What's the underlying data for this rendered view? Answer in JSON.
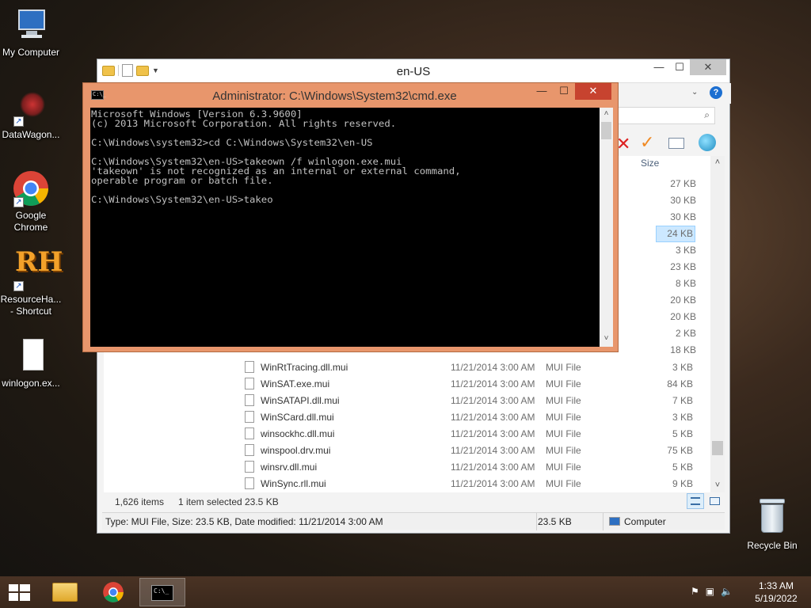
{
  "desktop": {
    "icons": [
      {
        "label": "My Computer"
      },
      {
        "label": "DataWagon..."
      },
      {
        "label": "Google Chrome"
      },
      {
        "label": "ResourceHa... - Shortcut"
      },
      {
        "label": "winlogon.ex..."
      },
      {
        "label": "Recycle Bin"
      }
    ]
  },
  "explorer": {
    "title": "en-US",
    "column_size": "Size",
    "upper_sizes": [
      "27 KB",
      "30 KB",
      "30 KB",
      "24 KB",
      "3 KB",
      "23 KB",
      "8 KB",
      "20 KB",
      "20 KB",
      "2 KB",
      "18 KB"
    ],
    "selected_index": 3,
    "rows": [
      {
        "name": "WinRtTracing.dll.mui",
        "date": "11/21/2014 3:00 AM",
        "type": "MUI File",
        "size": "3 KB"
      },
      {
        "name": "WinSAT.exe.mui",
        "date": "11/21/2014 3:00 AM",
        "type": "MUI File",
        "size": "84 KB"
      },
      {
        "name": "WinSATAPI.dll.mui",
        "date": "11/21/2014 3:00 AM",
        "type": "MUI File",
        "size": "7 KB"
      },
      {
        "name": "WinSCard.dll.mui",
        "date": "11/21/2014 3:00 AM",
        "type": "MUI File",
        "size": "3 KB"
      },
      {
        "name": "winsockhc.dll.mui",
        "date": "11/21/2014 3:00 AM",
        "type": "MUI File",
        "size": "5 KB"
      },
      {
        "name": "winspool.drv.mui",
        "date": "11/21/2014 3:00 AM",
        "type": "MUI File",
        "size": "75 KB"
      },
      {
        "name": "winsrv.dll.mui",
        "date": "11/21/2014 3:00 AM",
        "type": "MUI File",
        "size": "5 KB"
      },
      {
        "name": "WinSync.rll.mui",
        "date": "11/21/2014 3:00 AM",
        "type": "MUI File",
        "size": "9 KB"
      }
    ],
    "status": {
      "item_count": "1,626 items",
      "selected": "1 item selected",
      "selected_size": "23.5 KB"
    },
    "details_bar": {
      "info": "Type: MUI File, Size: 23.5 KB, Date modified: 11/21/2014 3:00 AM",
      "size": "23.5 KB",
      "location": "Computer"
    }
  },
  "cmd": {
    "title": "Administrator: C:\\Windows\\System32\\cmd.exe",
    "output": "Microsoft Windows [Version 6.3.9600]\n(c) 2013 Microsoft Corporation. All rights reserved.\n\nC:\\Windows\\system32>cd C:\\Windows\\System32\\en-US\n\nC:\\Windows\\System32\\en-US>takeown /f winlogon.exe.mui\n'takeown' is not recognized as an internal or external command,\noperable program or batch file.\n\nC:\\Windows\\System32\\en-US>takeo"
  },
  "taskbar": {
    "time": "1:33 AM",
    "date": "5/19/2022"
  },
  "icon_names": [
    "computer-icon",
    "datawagon-icon",
    "chrome-icon",
    "resource-hacker-icon",
    "document-icon",
    "recycle-bin-icon",
    "windows-start-icon",
    "file-explorer-icon",
    "cmd-icon",
    "flag-icon",
    "network-icon",
    "speaker-muted-icon"
  ]
}
